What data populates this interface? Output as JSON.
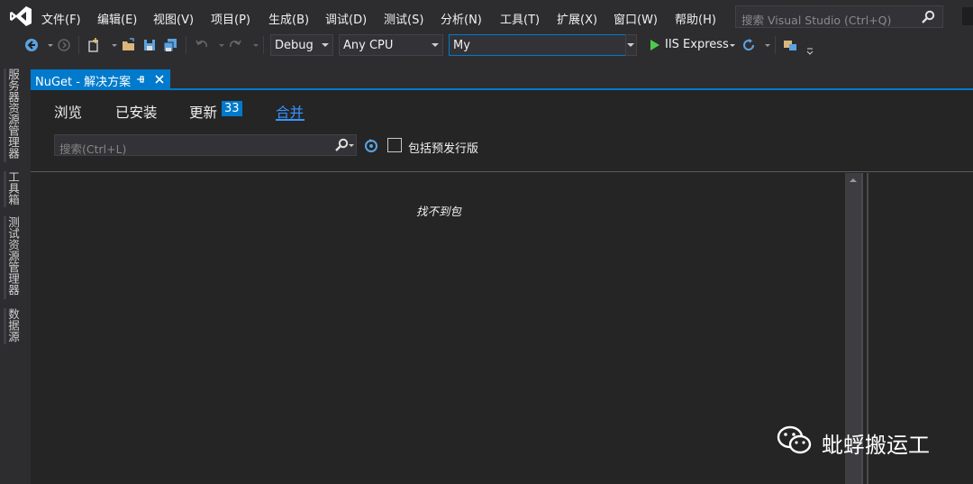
{
  "menu": {
    "items": [
      "文件(F)",
      "编辑(E)",
      "视图(V)",
      "项目(P)",
      "生成(B)",
      "调试(D)",
      "测试(S)",
      "分析(N)",
      "工具(T)",
      "扩展(X)",
      "窗口(W)",
      "帮助(H)"
    ],
    "search_placeholder": "搜索 Visual Studio (Ctrl+Q)"
  },
  "toolbar": {
    "configuration": "Debug",
    "platform": "Any CPU",
    "startup_project": "My",
    "run_label": "IIS Express"
  },
  "left_strip": {
    "tabs": [
      "服务器资源管理器",
      "工具箱",
      "测试资源管理器",
      "数据源"
    ]
  },
  "document_tab": {
    "title": "NuGet - 解决方案"
  },
  "nuget": {
    "tabs": {
      "browse": "浏览",
      "installed": "已安装",
      "updates": "更新",
      "consolidate": "合并"
    },
    "updates_count": "33",
    "search_placeholder": "搜索(Ctrl+L)",
    "include_prerelease": "包括预发行版",
    "empty_message": "找不到包"
  },
  "watermark": {
    "text": "蚍蜉搬运工"
  },
  "colors": {
    "accent": "#007acc",
    "active_tab": "#3794ff",
    "background": "#2d2d30",
    "pane": "#252526"
  }
}
